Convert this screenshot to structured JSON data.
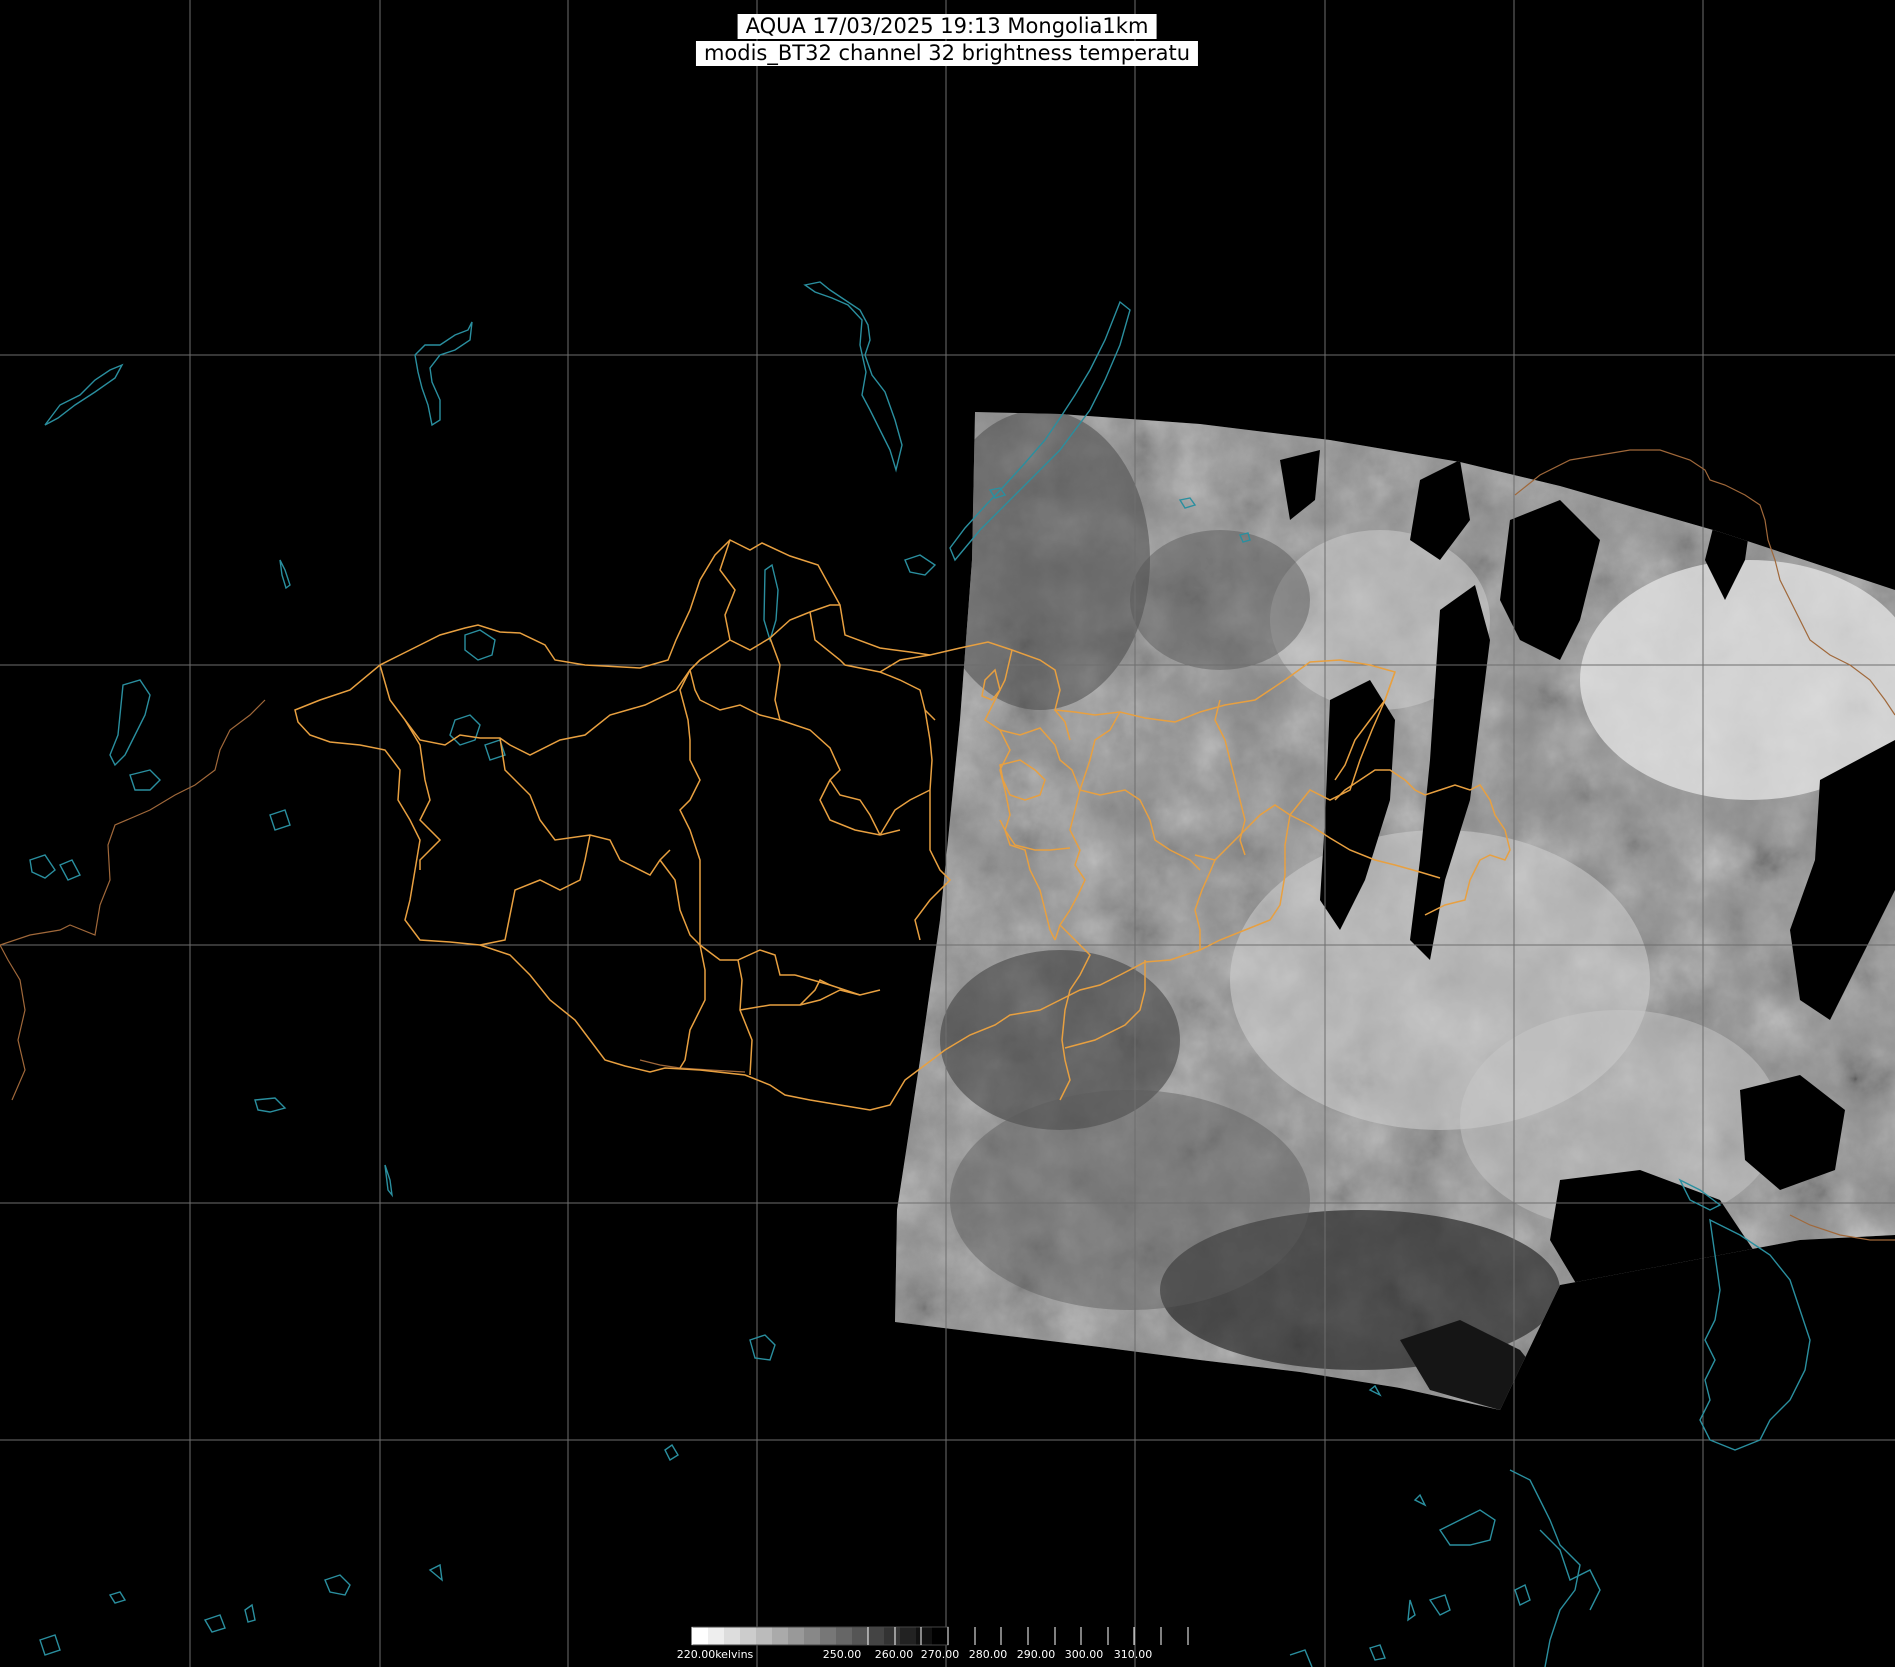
{
  "header": {
    "line1": "AQUA 17/03/2025 19:13 Mongolia1km",
    "line2": "modis_BT32 channel 32 brightness temperatu"
  },
  "legend": {
    "labels": [
      "220.00kelvins",
      "250.00",
      "260.00",
      "270.00",
      "280.00",
      "290.00",
      "300.00",
      "310.00"
    ],
    "gradient": [
      "#ffffff",
      "#000000"
    ]
  },
  "colors": {
    "background": "#000000",
    "graticule": "#6e6e6e",
    "admin_boundaries": "#f0a040",
    "coastlines_water": "#2a8f9f",
    "imagery_gray": "#9a9a9a"
  }
}
